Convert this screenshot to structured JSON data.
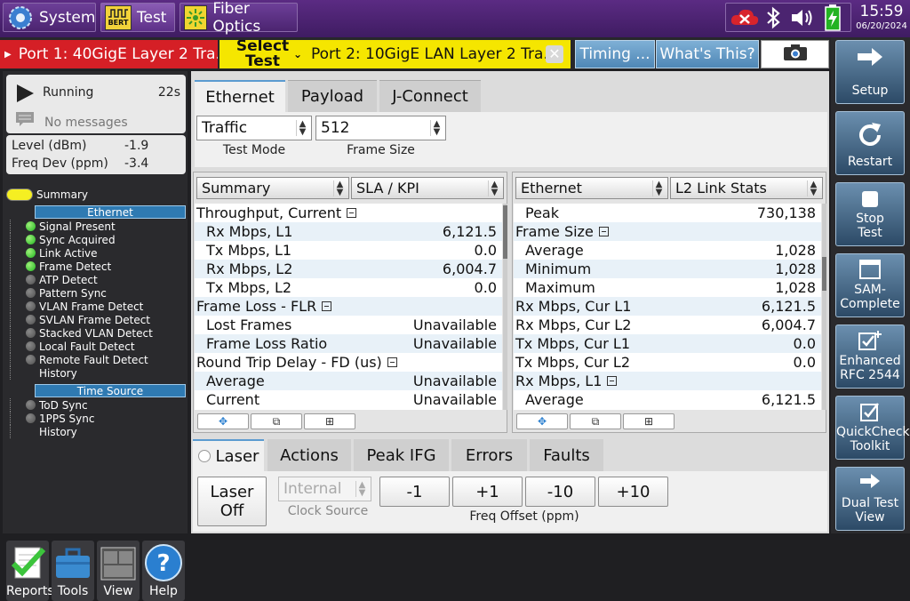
{
  "topbar": {
    "system_label": "System",
    "test_label": "Test",
    "bert_label": "BERT",
    "fiber_label": "Fiber Optics",
    "time": "15:59",
    "date": "06/20/2024"
  },
  "tabs": {
    "port1": "Port 1: 40GigE Layer 2 Tra...",
    "select_test_line1": "Select",
    "select_test_line2": "Test",
    "port2": "Port 2: 10GigE LAN Layer 2 Tra...",
    "timing": "Timing ...",
    "whats_this": "What's This?"
  },
  "left": {
    "run_state": "Running",
    "elapsed": "22s",
    "messages": "No messages",
    "level_label": "Level (dBm)",
    "level_value": "-1.9",
    "freq_label": "Freq Dev (ppm)",
    "freq_value": "-3.4",
    "summary_label": "Summary",
    "ethernet_header": "Ethernet",
    "ethernet_items": [
      {
        "label": "Signal Present",
        "status": "green"
      },
      {
        "label": "Sync Acquired",
        "status": "green"
      },
      {
        "label": "Link Active",
        "status": "green"
      },
      {
        "label": "Frame Detect",
        "status": "green"
      },
      {
        "label": "ATP Detect",
        "status": "grey"
      },
      {
        "label": "Pattern Sync",
        "status": "grey"
      },
      {
        "label": "VLAN Frame Detect",
        "status": "grey"
      },
      {
        "label": "SVLAN Frame Detect",
        "status": "grey"
      },
      {
        "label": "Stacked VLAN Detect",
        "status": "grey"
      },
      {
        "label": "Local Fault Detect",
        "status": "grey"
      },
      {
        "label": "Remote Fault Detect",
        "status": "grey"
      },
      {
        "label": "History",
        "status": "none"
      }
    ],
    "timesource_header": "Time Source",
    "timesource_items": [
      {
        "label": "ToD Sync",
        "status": "grey"
      },
      {
        "label": "1PPS Sync",
        "status": "grey"
      },
      {
        "label": "History",
        "status": "none"
      }
    ],
    "buttons": {
      "reports": "Reports",
      "tools": "Tools",
      "view": "View",
      "help": "Help"
    }
  },
  "main": {
    "tabs": [
      "Ethernet",
      "Payload",
      "J-Connect"
    ],
    "test_mode_value": "Traffic",
    "test_mode_caption": "Test Mode",
    "frame_size_value": "512",
    "frame_size_caption": "Frame Size",
    "left_grid": {
      "dd1": "Summary",
      "dd2": "SLA / KPI",
      "rows": [
        {
          "k": "Throughput, Current",
          "v": "",
          "section": true
        },
        {
          "k": "Rx Mbps, L1",
          "v": "6,121.5"
        },
        {
          "k": "Tx Mbps, L1",
          "v": "0.0"
        },
        {
          "k": "Rx Mbps, L2",
          "v": "6,004.7"
        },
        {
          "k": "Tx Mbps, L2",
          "v": "0.0"
        },
        {
          "k": "Frame Loss - FLR",
          "v": "",
          "section": true
        },
        {
          "k": "Lost Frames",
          "v": "Unavailable"
        },
        {
          "k": "Frame Loss Ratio",
          "v": "Unavailable"
        },
        {
          "k": "Round Trip Delay - FD (us)",
          "v": "",
          "section": true
        },
        {
          "k": "Average",
          "v": "Unavailable"
        },
        {
          "k": "Current",
          "v": "Unavailable"
        }
      ]
    },
    "right_grid": {
      "dd1": "Ethernet",
      "dd2": "L2 Link Stats",
      "rows": [
        {
          "k": "Peak",
          "v": "730,138"
        },
        {
          "k": "Frame Size",
          "v": "",
          "section": true
        },
        {
          "k": "Average",
          "v": "1,028"
        },
        {
          "k": "Minimum",
          "v": "1,028"
        },
        {
          "k": "Maximum",
          "v": "1,028"
        },
        {
          "k": "Rx Mbps, Cur L1",
          "v": "6,121.5",
          "flush": true
        },
        {
          "k": "Rx Mbps, Cur L2",
          "v": "6,004.7",
          "flush": true
        },
        {
          "k": "Tx Mbps, Cur L1",
          "v": "0.0",
          "flush": true
        },
        {
          "k": "Tx Mbps, Cur L2",
          "v": "0.0",
          "flush": true
        },
        {
          "k": "Rx Mbps, L1",
          "v": "",
          "section": true
        },
        {
          "k": "Average",
          "v": "6,121.5"
        }
      ]
    },
    "bottom_tabs": [
      "Laser",
      "Actions",
      "Peak IFG",
      "Errors",
      "Faults"
    ],
    "laser_off_line1": "Laser",
    "laser_off_line2": "Off",
    "clock_source_value": "Internal",
    "clock_source_caption": "Clock Source",
    "freq_buttons": [
      "-1",
      "+1",
      "-10",
      "+10"
    ],
    "freq_caption": "Freq Offset (ppm)"
  },
  "right": {
    "setup": "Setup",
    "restart": "Restart",
    "stop_line1": "Stop",
    "stop_line2": "Test",
    "sam_line1": "SAM-",
    "sam_line2": "Complete",
    "rfc_line1": "Enhanced",
    "rfc_line2": "RFC 2544",
    "quick_line1": "QuickCheck",
    "quick_line2": "Toolkit",
    "dual_line1": "Dual Test",
    "dual_line2": "View"
  }
}
